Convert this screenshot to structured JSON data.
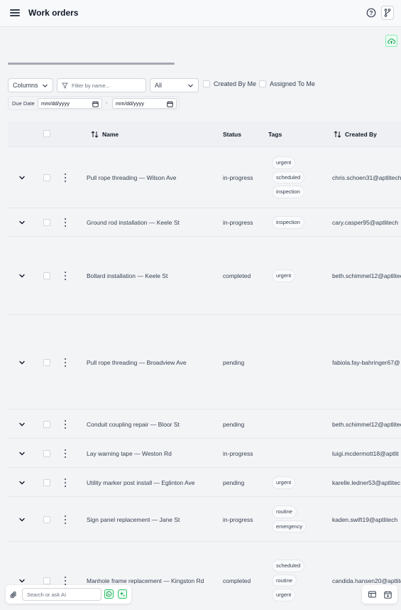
{
  "header": {
    "title": "Work orders",
    "menu_icon": "hamburger-icon",
    "help_icon": "help-circle-icon",
    "branch_icon": "git-branch-icon"
  },
  "upload_icon": "cloud-upload-icon",
  "toolbar": {
    "columns_label": "Columns",
    "filter_placeholder": "Filter by name...",
    "status_select_value": "All",
    "created_by_me_label": "Created By Me",
    "assigned_to_me_label": "Assigned To Me",
    "due_date_label": "Due Date",
    "date_from_value": "mm/dd/yyyy",
    "date_separator": "-",
    "date_to_value": "mm/dd/yyyy"
  },
  "table": {
    "headers": {
      "name": "Name",
      "status": "Status",
      "tags": "Tags",
      "created_by": "Created By"
    },
    "rows": [
      {
        "name": "Pull rope threading — Wilson Ave",
        "status": "in-progress",
        "tags": [
          "urgent",
          "scheduled",
          "inspection"
        ],
        "created_by": "chris.schoen31@aptlitech"
      },
      {
        "name": "Ground rod installation — Keele St",
        "status": "in-progress",
        "tags": [
          "inspection"
        ],
        "created_by": "cary.casper95@aptlitech"
      },
      {
        "name": "Bollard installation — Keele St",
        "status": "completed",
        "tags": [
          "urgent"
        ],
        "created_by": "beth.schimmel12@aptlitech"
      },
      {
        "name": "Pull rope threading — Broadview Ave",
        "status": "pending",
        "tags": [],
        "created_by": "fabiola.fay-bahringer67@"
      },
      {
        "name": "Conduit coupling repair — Bloor St",
        "status": "pending",
        "tags": [],
        "created_by": "beth.schimmel12@aptlitech"
      },
      {
        "name": "Lay warning tape — Weston Rd",
        "status": "in-progress",
        "tags": [],
        "created_by": "luigi.mcdermott18@aptlit"
      },
      {
        "name": "Utility marker post install — Eglinton Ave",
        "status": "pending",
        "tags": [
          "urgent"
        ],
        "created_by": "karelle.ledner53@aptlitec"
      },
      {
        "name": "Sign panel replacement — Jane St",
        "status": "in-progress",
        "tags": [
          "routine",
          "emergency"
        ],
        "created_by": "kaden.swift19@aptlitech"
      },
      {
        "name": "Manhole frame replacement — Kingston Rd",
        "status": "completed",
        "tags": [
          "scheduled",
          "routine",
          "urgent"
        ],
        "created_by": "candida.hansen20@aptlite"
      }
    ]
  },
  "bottom_bar": {
    "ai_placeholder": "Search or ask AI"
  }
}
